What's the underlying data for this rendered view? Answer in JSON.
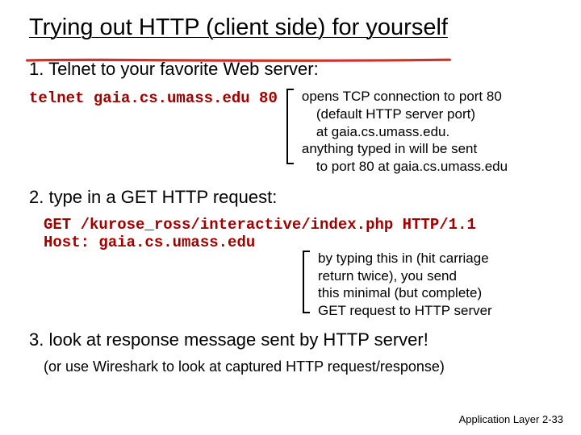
{
  "title": "Trying out HTTP (client side) for yourself",
  "step1": {
    "label": "1. Telnet to your favorite Web server:",
    "command": "telnet gaia.cs.umass.edu 80",
    "note_l1": "opens TCP connection to port 80",
    "note_l2": "(default HTTP server port)",
    "note_l3": "at gaia.cs.umass.edu.",
    "note_l4": "anything typed in will be sent",
    "note_l5": "to port 80 at gaia.cs.umass.edu"
  },
  "step2": {
    "label": "2. type in a GET HTTP request:",
    "code_l1": "GET /kurose_ross/interactive/index.php HTTP/1.1",
    "code_l2": "Host: gaia.cs.umass.edu",
    "note_l1": "by typing this in (hit carriage",
    "note_l2": "return twice), you send",
    "note_l3": "this minimal (but complete)",
    "note_l4": "GET request to HTTP server"
  },
  "step3": {
    "label": "3. look at response message sent by HTTP server!",
    "sub": "(or use Wireshark to look at captured HTTP request/response)"
  },
  "footer": {
    "section": "Application Layer",
    "page": "2-33"
  }
}
